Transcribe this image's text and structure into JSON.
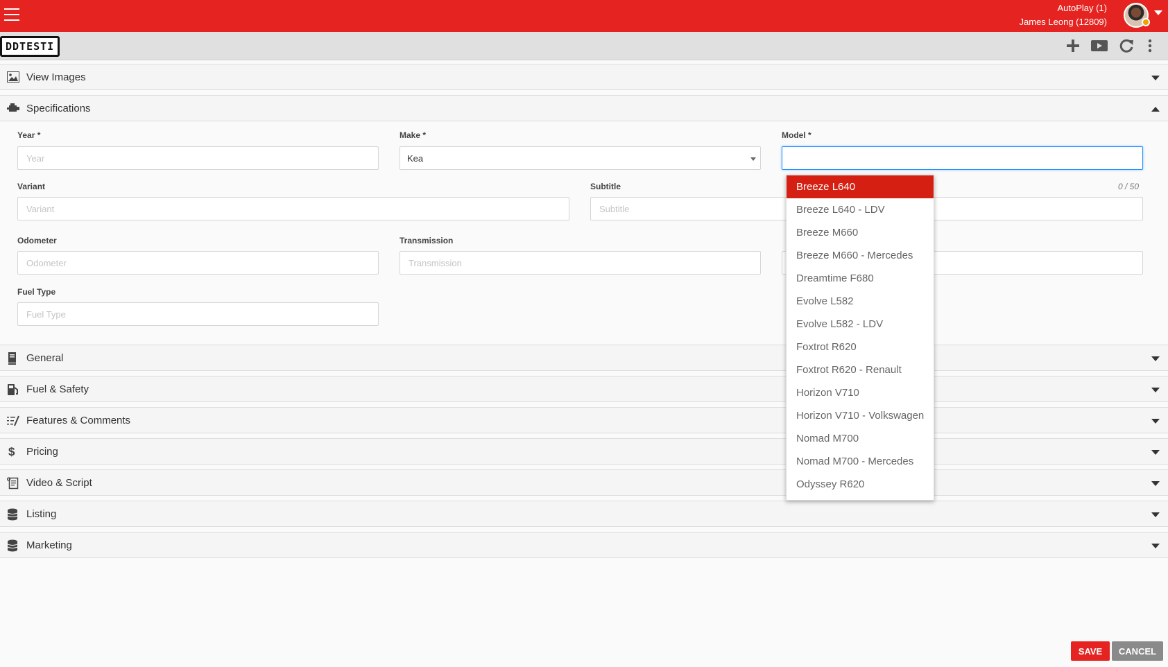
{
  "header": {
    "app_line": "AutoPlay (1)",
    "user_line": "James Leong (12809)",
    "menu_icon": "hamburger-menu-icon",
    "accent_color": "#e52421"
  },
  "toolbar": {
    "logo_text": "DDTESTI",
    "icons": [
      "plus-icon",
      "video-icon",
      "refresh-icon",
      "more-vertical-icon"
    ]
  },
  "panels": {
    "view_images": "View Images",
    "specifications": "Specifications",
    "general": "General",
    "fuel_safety": "Fuel & Safety",
    "features_comments": "Features & Comments",
    "pricing": "Pricing",
    "video_script": "Video & Script",
    "listing": "Listing",
    "marketing": "Marketing"
  },
  "form": {
    "year": {
      "label": "Year *",
      "placeholder": "Year",
      "value": ""
    },
    "make": {
      "label": "Make *",
      "value": "Kea"
    },
    "model": {
      "label": "Model *",
      "value": ""
    },
    "variant": {
      "label": "Variant",
      "placeholder": "Variant",
      "value": ""
    },
    "subtitle": {
      "label": "Subtitle",
      "placeholder": "Subtitle",
      "value": "",
      "counter": "0 / 50"
    },
    "odometer": {
      "label": "Odometer",
      "placeholder": "Odometer",
      "value": ""
    },
    "transmission": {
      "label": "Transmission",
      "placeholder": "Transmission",
      "value": ""
    },
    "fuel_type": {
      "label": "Fuel Type",
      "placeholder": "Fuel Type",
      "value": ""
    }
  },
  "model_dropdown": {
    "selected_index": 0,
    "options": [
      "Breeze L640",
      "Breeze L640 - LDV",
      "Breeze M660",
      "Breeze M660 - Mercedes",
      "Dreamtime F680",
      "Evolve L582",
      "Evolve L582 - LDV",
      "Foxtrot R620",
      "Foxtrot R620 - Renault",
      "Horizon V710",
      "Horizon V710 - Volkswagen",
      "Nomad M700",
      "Nomad M700 - Mercedes",
      "Odyssey R620"
    ]
  },
  "footer": {
    "save_label": "SAVE",
    "cancel_label": "CANCEL"
  }
}
